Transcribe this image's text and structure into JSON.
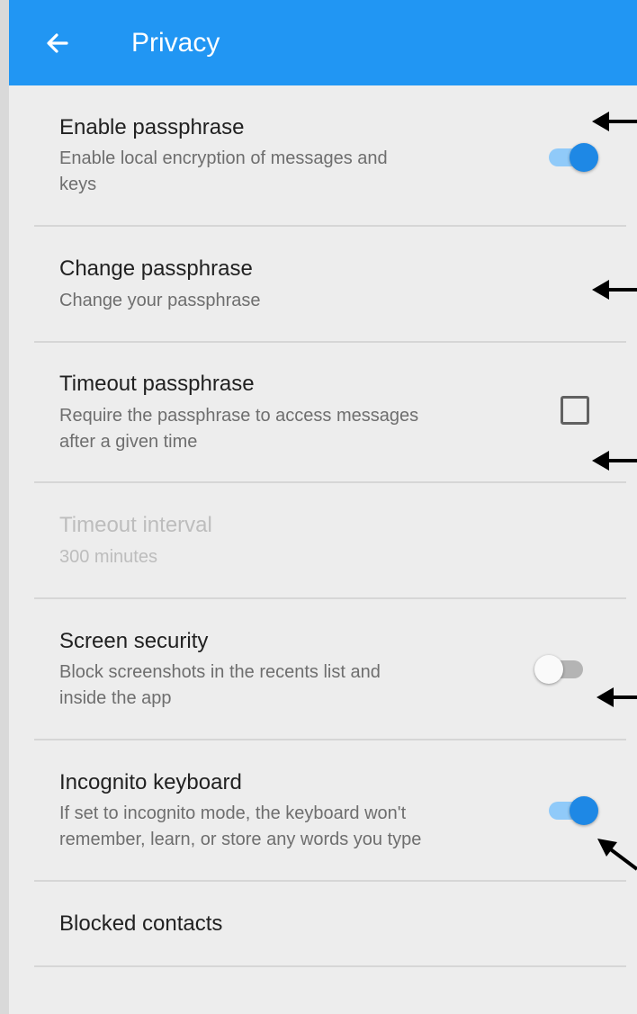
{
  "appbar": {
    "title": "Privacy",
    "back_icon": "arrow-back-icon",
    "color": "#2196f3"
  },
  "settings": [
    {
      "key": "enable-passphrase",
      "title": "Enable passphrase",
      "summary_lines": [
        "Enable local encryption of messages and",
        "keys"
      ],
      "control": "switch",
      "checked": true
    },
    {
      "key": "change-passphrase",
      "title": "Change passphrase",
      "summary_lines": [
        "Change your passphrase"
      ],
      "control": "none"
    },
    {
      "key": "timeout-passphrase",
      "title": "Timeout passphrase",
      "summary_lines": [
        "Require the passphrase to access messages",
        "after a given time"
      ],
      "control": "checkbox",
      "checked": false
    },
    {
      "key": "timeout-interval",
      "title": "Timeout interval",
      "summary_lines": [
        "300 minutes"
      ],
      "control": "none",
      "enabled": false
    },
    {
      "key": "screen-security",
      "title": "Screen security",
      "summary_lines": [
        "Block screenshots in the recents list and",
        "inside the app"
      ],
      "control": "switch",
      "checked": false
    },
    {
      "key": "incognito-keyboard",
      "title": "Incognito keyboard",
      "summary_lines": [
        "If set to incognito mode, the keyboard won't",
        "remember, learn, or store any words you type"
      ],
      "control": "switch",
      "checked": true
    },
    {
      "key": "blocked-contacts",
      "title": "Blocked contacts",
      "summary_lines": [],
      "control": "none"
    }
  ],
  "accent_color": "#1e88e5",
  "annotation_arrow_icon": "annotation-arrow-icon"
}
